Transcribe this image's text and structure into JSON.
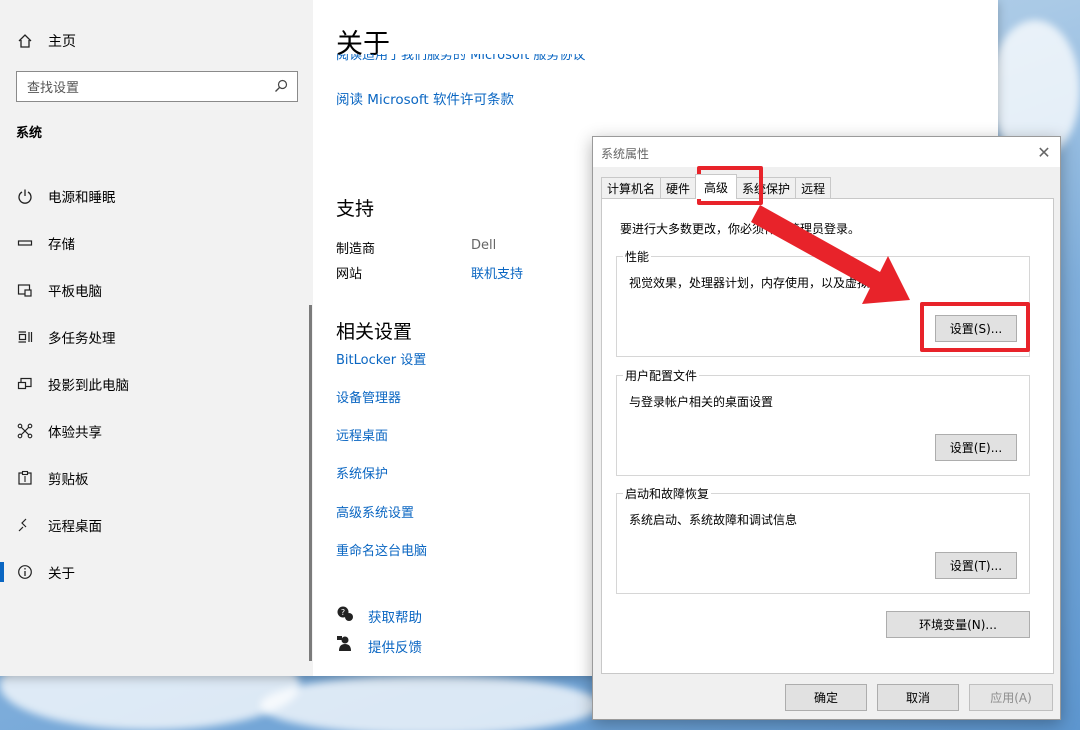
{
  "sidebar": {
    "home_label": "主页",
    "search_placeholder": "查找设置",
    "section": "系统",
    "items": [
      {
        "label": "电源和睡眠",
        "icon": "power-icon"
      },
      {
        "label": "存储",
        "icon": "storage-icon"
      },
      {
        "label": "平板电脑",
        "icon": "tablet-icon"
      },
      {
        "label": "多任务处理",
        "icon": "multitask-icon"
      },
      {
        "label": "投影到此电脑",
        "icon": "project-icon"
      },
      {
        "label": "体验共享",
        "icon": "share-icon"
      },
      {
        "label": "剪贴板",
        "icon": "clipboard-icon"
      },
      {
        "label": "远程桌面",
        "icon": "remote-desktop-icon"
      },
      {
        "label": "关于",
        "icon": "info-icon",
        "selected": true
      }
    ]
  },
  "content": {
    "title": "关于",
    "clipped_link": "阅读适用于我们服务的 Microsoft 服务协议",
    "license_link": "阅读 Microsoft 软件许可条款",
    "support_heading": "支持",
    "support_rows": [
      {
        "key": "制造商",
        "value": "Dell",
        "is_link": false
      },
      {
        "key": "网站",
        "value": "联机支持",
        "is_link": true
      }
    ],
    "related_heading": "相关设置",
    "related_links": [
      "BitLocker 设置",
      "设备管理器",
      "远程桌面",
      "系统保护",
      "高级系统设置",
      "重命名这台电脑"
    ],
    "help_items": [
      {
        "label": "获取帮助",
        "icon": "help-chat-icon"
      },
      {
        "label": "提供反馈",
        "icon": "feedback-icon"
      }
    ]
  },
  "dialog": {
    "title": "系统属性",
    "tabs": [
      "计算机名",
      "硬件",
      "高级",
      "系统保护",
      "远程"
    ],
    "active_tab": "高级",
    "admin_note": "要进行大多数更改，你必须作为管理员登录。",
    "groups": [
      {
        "label": "性能",
        "desc": "视觉效果，处理器计划，内存使用，以及虚拟内存",
        "button": "设置(S)..."
      },
      {
        "label": "用户配置文件",
        "desc": "与登录帐户相关的桌面设置",
        "button": "设置(E)..."
      },
      {
        "label": "启动和故障恢复",
        "desc": "系统启动、系统故障和调试信息",
        "button": "设置(T)..."
      }
    ],
    "env_button": "环境变量(N)...",
    "ok_button": "确定",
    "cancel_button": "取消",
    "apply_button": "应用(A)"
  },
  "colors": {
    "accent": "#0a66c2",
    "highlight": "#e8232a"
  }
}
